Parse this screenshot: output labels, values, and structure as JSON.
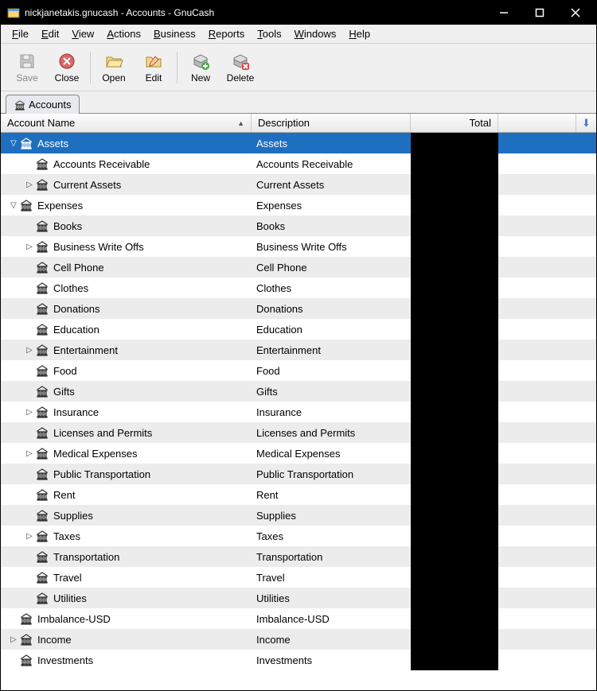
{
  "window": {
    "title": "nickjanetakis.gnucash - Accounts - GnuCash"
  },
  "menu": {
    "file": "File",
    "edit": "Edit",
    "view": "View",
    "actions": "Actions",
    "business": "Business",
    "reports": "Reports",
    "tools": "Tools",
    "windows": "Windows",
    "help": "Help"
  },
  "toolbar": {
    "save": "Save",
    "close": "Close",
    "open": "Open",
    "edit": "Edit",
    "new": "New",
    "delete": "Delete"
  },
  "tab": {
    "label": "Accounts"
  },
  "columns": {
    "name": "Account Name",
    "description": "Description",
    "total": "Total"
  },
  "rows": [
    {
      "level": 0,
      "expander": "down",
      "name": "Assets",
      "desc": "Assets",
      "selected": true
    },
    {
      "level": 1,
      "expander": "",
      "name": "Accounts Receivable",
      "desc": "Accounts Receivable"
    },
    {
      "level": 1,
      "expander": "right",
      "name": "Current Assets",
      "desc": "Current Assets"
    },
    {
      "level": 0,
      "expander": "down",
      "name": "Expenses",
      "desc": "Expenses"
    },
    {
      "level": 1,
      "expander": "",
      "name": "Books",
      "desc": "Books"
    },
    {
      "level": 1,
      "expander": "right",
      "name": "Business Write Offs",
      "desc": "Business Write Offs"
    },
    {
      "level": 1,
      "expander": "",
      "name": "Cell Phone",
      "desc": "Cell Phone"
    },
    {
      "level": 1,
      "expander": "",
      "name": "Clothes",
      "desc": "Clothes"
    },
    {
      "level": 1,
      "expander": "",
      "name": "Donations",
      "desc": "Donations"
    },
    {
      "level": 1,
      "expander": "",
      "name": "Education",
      "desc": "Education"
    },
    {
      "level": 1,
      "expander": "right",
      "name": "Entertainment",
      "desc": "Entertainment"
    },
    {
      "level": 1,
      "expander": "",
      "name": "Food",
      "desc": "Food"
    },
    {
      "level": 1,
      "expander": "",
      "name": "Gifts",
      "desc": "Gifts"
    },
    {
      "level": 1,
      "expander": "right",
      "name": "Insurance",
      "desc": "Insurance"
    },
    {
      "level": 1,
      "expander": "",
      "name": "Licenses and Permits",
      "desc": "Licenses and Permits"
    },
    {
      "level": 1,
      "expander": "right",
      "name": "Medical Expenses",
      "desc": "Medical Expenses"
    },
    {
      "level": 1,
      "expander": "",
      "name": "Public Transportation",
      "desc": "Public Transportation"
    },
    {
      "level": 1,
      "expander": "",
      "name": "Rent",
      "desc": "Rent"
    },
    {
      "level": 1,
      "expander": "",
      "name": "Supplies",
      "desc": "Supplies"
    },
    {
      "level": 1,
      "expander": "right",
      "name": "Taxes",
      "desc": "Taxes"
    },
    {
      "level": 1,
      "expander": "",
      "name": "Transportation",
      "desc": "Transportation"
    },
    {
      "level": 1,
      "expander": "",
      "name": "Travel",
      "desc": "Travel"
    },
    {
      "level": 1,
      "expander": "",
      "name": "Utilities",
      "desc": "Utilities"
    },
    {
      "level": 0,
      "expander": "",
      "name": "Imbalance-USD",
      "desc": "Imbalance-USD"
    },
    {
      "level": 0,
      "expander": "right",
      "name": "Income",
      "desc": "Income"
    },
    {
      "level": 0,
      "expander": "",
      "name": "Investments",
      "desc": "Investments"
    }
  ]
}
